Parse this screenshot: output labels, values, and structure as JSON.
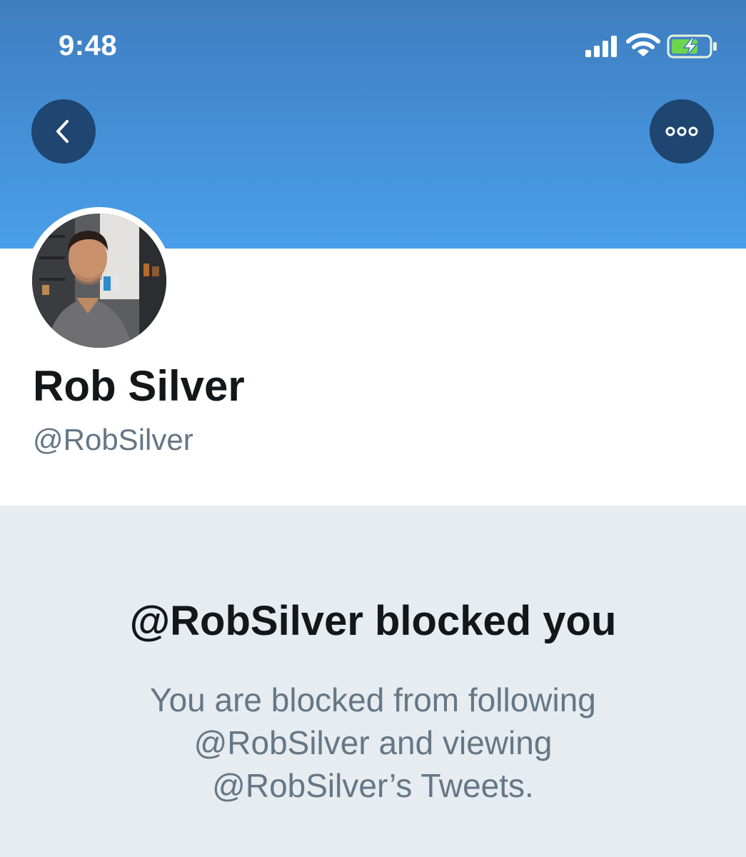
{
  "status_bar": {
    "time": "9:48",
    "icons": [
      "signal-icon",
      "wifi-icon",
      "battery-charging-icon"
    ]
  },
  "header": {
    "back_icon": "chevron-left-icon",
    "more_icon": "more-options-icon",
    "gradient_colors": [
      "#3f7dc0",
      "#4a9ee8"
    ],
    "button_color": "#1e4670"
  },
  "profile": {
    "name": "Rob Silver",
    "handle": "@RobSilver"
  },
  "blocked": {
    "title": "@RobSilver blocked you",
    "description_lines": [
      "You are blocked from following",
      "@RobSilver and viewing",
      "@RobSilver’s Tweets."
    ]
  },
  "colors": {
    "primary_text": "#14171a",
    "secondary_text": "#657786",
    "panel_bg": "#e6ecf0"
  }
}
